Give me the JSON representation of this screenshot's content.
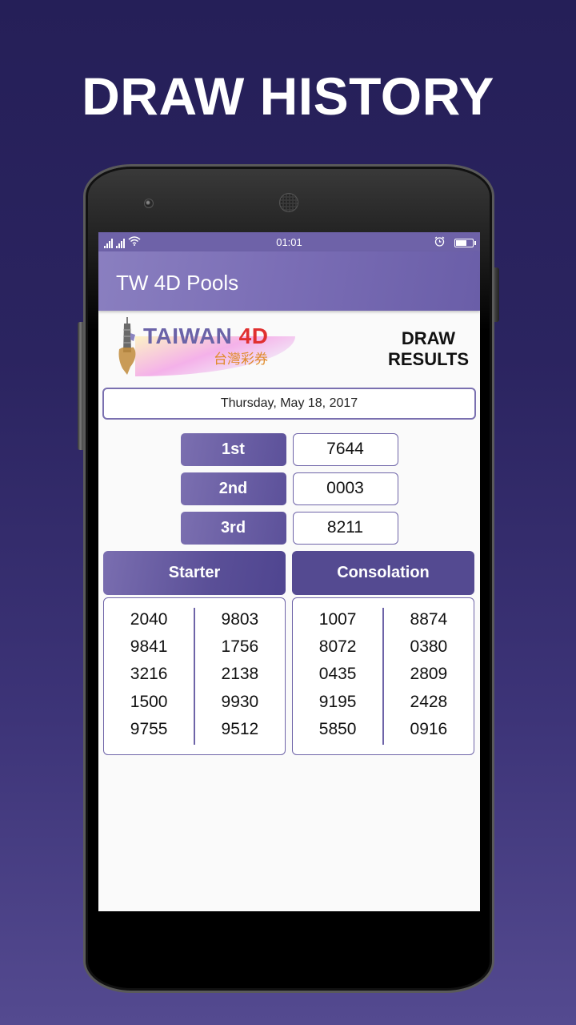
{
  "promo": {
    "title": "DRAW HISTORY"
  },
  "statusbar": {
    "time": "01:01",
    "icons": [
      "signal-icon",
      "signal-icon",
      "wifi-icon",
      "alarm-icon",
      "battery-icon"
    ],
    "battery_level": 0.6
  },
  "appbar": {
    "title": "TW 4D Pools"
  },
  "logo": {
    "brand": "TAIWAN",
    "brand_accent": "4D",
    "subtitle_cn": "台灣彩券"
  },
  "header": {
    "line1": "DRAW",
    "line2": "RESULTS"
  },
  "draw_date": "Thursday, May 18, 2017",
  "prizes": [
    {
      "label": "1st",
      "number": "7644"
    },
    {
      "label": "2nd",
      "number": "0003"
    },
    {
      "label": "3rd",
      "number": "8211"
    }
  ],
  "starter": {
    "title": "Starter",
    "left": [
      "2040",
      "9841",
      "3216",
      "1500",
      "9755"
    ],
    "right": [
      "9803",
      "1756",
      "2138",
      "9930",
      "9512"
    ]
  },
  "consolation": {
    "title": "Consolation",
    "left": [
      "1007",
      "8072",
      "0435",
      "9195",
      "5850"
    ],
    "right": [
      "8874",
      "0380",
      "2809",
      "2428",
      "0916"
    ]
  },
  "colors": {
    "accent": "#5c519a",
    "appbar": "#7a6db5",
    "border": "#6e64a8",
    "background_top": "#251f58",
    "background_bottom": "#544a90"
  }
}
